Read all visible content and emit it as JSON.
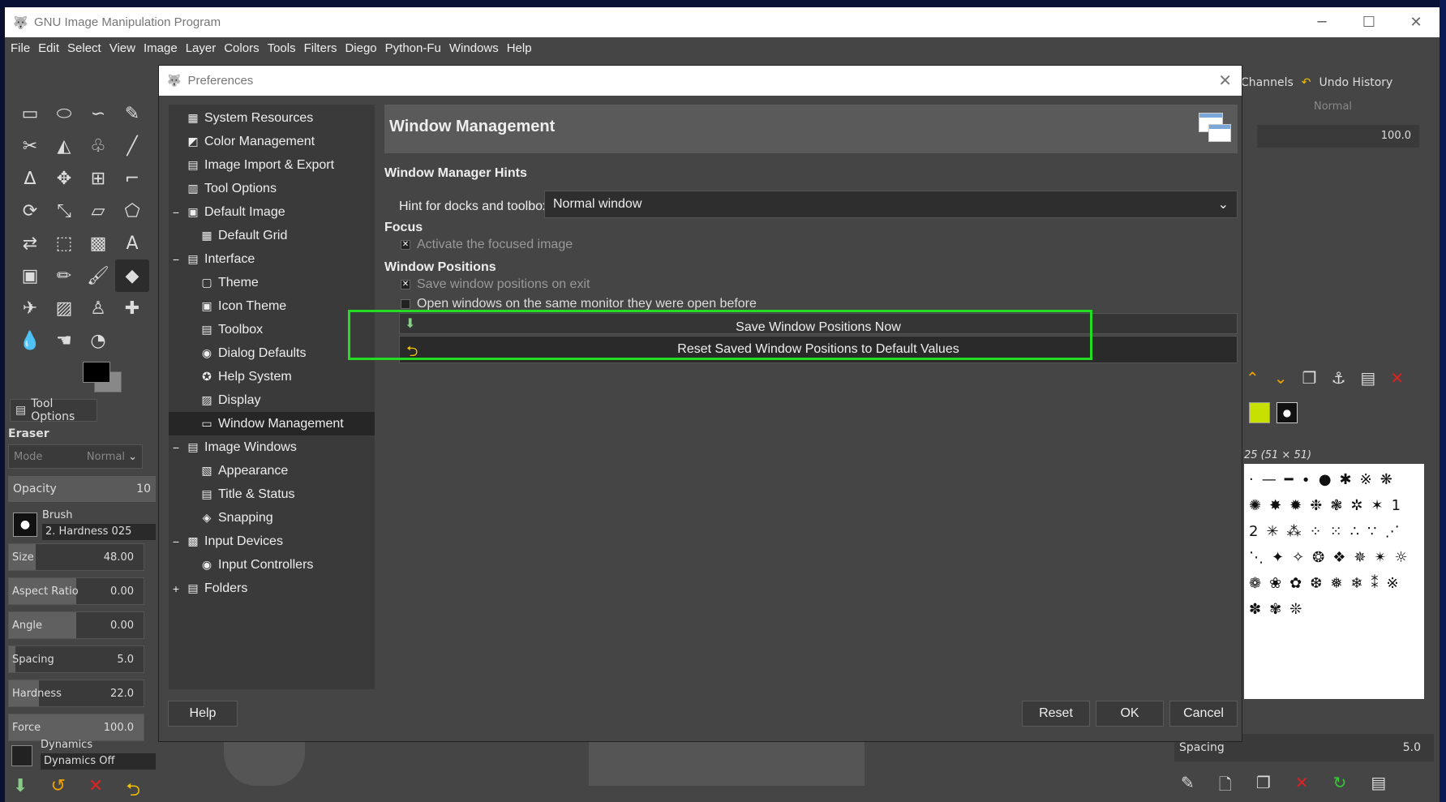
{
  "app": {
    "title": "GNU Image Manipulation Program"
  },
  "menubar": [
    "File",
    "Edit",
    "Select",
    "View",
    "Image",
    "Layer",
    "Colors",
    "Tools",
    "Filters",
    "Diego",
    "Python-Fu",
    "Windows",
    "Help"
  ],
  "toolbox": {
    "tool_options_tab": "Tool Options",
    "tool_name": "Eraser",
    "mode_label": "Mode",
    "mode_value": "Normal",
    "opacity_label": "Opacity",
    "opacity_value": "10",
    "brush_label": "Brush",
    "brush_value": "2. Hardness 025",
    "sliders": [
      {
        "label": "Size",
        "value": "48.00"
      },
      {
        "label": "Aspect Ratio",
        "value": "0.00"
      },
      {
        "label": "Angle",
        "value": "0.00"
      },
      {
        "label": "Spacing",
        "value": "5.0"
      },
      {
        "label": "Hardness",
        "value": "22.0"
      },
      {
        "label": "Force",
        "value": "100.0"
      }
    ],
    "dynamics_label": "Dynamics",
    "dynamics_value": "Dynamics Off"
  },
  "dock": {
    "tab_channels": "Channels",
    "tab_undo_history": "Undo History",
    "mode": "Normal",
    "opacity_value": "100.0",
    "brush_info": "25 (51 × 51)",
    "brush_number": "12",
    "spacing_label": "Spacing",
    "spacing_value": "5.0"
  },
  "dialog": {
    "title": "Preferences",
    "tree": [
      {
        "label": "System Resources",
        "level": 0,
        "icon": "system-resources-icon",
        "glyph": "▦"
      },
      {
        "label": "Color Management",
        "level": 0,
        "icon": "color-management-icon",
        "glyph": "◩"
      },
      {
        "label": "Image Import & Export",
        "level": 0,
        "icon": "image-import-export-icon",
        "glyph": "▤"
      },
      {
        "label": "Tool Options",
        "level": 0,
        "icon": "tool-options-icon",
        "glyph": "▥"
      },
      {
        "label": "Default Image",
        "level": 0,
        "icon": "default-image-icon",
        "glyph": "▣",
        "expander": "−"
      },
      {
        "label": "Default Grid",
        "level": 1,
        "icon": "default-grid-icon",
        "glyph": "▦"
      },
      {
        "label": "Interface",
        "level": 0,
        "icon": "interface-icon",
        "glyph": "▤",
        "expander": "−"
      },
      {
        "label": "Theme",
        "level": 1,
        "icon": "theme-icon",
        "glyph": "▢"
      },
      {
        "label": "Icon Theme",
        "level": 1,
        "icon": "icon-theme-icon",
        "glyph": "▣"
      },
      {
        "label": "Toolbox",
        "level": 1,
        "icon": "toolbox-icon",
        "glyph": "▤"
      },
      {
        "label": "Dialog Defaults",
        "level": 1,
        "icon": "dialog-defaults-icon",
        "glyph": "◉"
      },
      {
        "label": "Help System",
        "level": 1,
        "icon": "help-system-icon",
        "glyph": "✪"
      },
      {
        "label": "Display",
        "level": 1,
        "icon": "display-icon",
        "glyph": "▨"
      },
      {
        "label": "Window Management",
        "level": 1,
        "icon": "window-management-icon",
        "glyph": "▭",
        "selected": true
      },
      {
        "label": "Image Windows",
        "level": 0,
        "icon": "image-windows-icon",
        "glyph": "▤",
        "expander": "−"
      },
      {
        "label": "Appearance",
        "level": 1,
        "icon": "appearance-icon",
        "glyph": "▧"
      },
      {
        "label": "Title & Status",
        "level": 1,
        "icon": "title-status-icon",
        "glyph": "▤"
      },
      {
        "label": "Snapping",
        "level": 1,
        "icon": "snapping-icon",
        "glyph": "◈"
      },
      {
        "label": "Input Devices",
        "level": 0,
        "icon": "input-devices-icon",
        "glyph": "▩",
        "expander": "−"
      },
      {
        "label": "Input Controllers",
        "level": 1,
        "icon": "input-controllers-icon",
        "glyph": "◉"
      },
      {
        "label": "Folders",
        "level": 0,
        "icon": "folders-icon",
        "glyph": "▤",
        "expander": "+"
      }
    ],
    "page_title": "Window Management",
    "wm_hints_title": "Window Manager Hints",
    "hint_label": "Hint for docks and toolbox:",
    "hint_value": "Normal window",
    "focus_title": "Focus",
    "focus_checkbox": "Activate the focused image",
    "positions_title": "Window Positions",
    "save_on_exit_checkbox": "Save window positions on exit",
    "same_monitor_checkbox": "Open windows on the same monitor they were open before",
    "save_now_button": "Save Window Positions Now",
    "reset_button": "Reset Saved Window Positions to Default Values",
    "help_button": "Help",
    "reset_dialog_button": "Reset",
    "ok_button": "OK",
    "cancel_button": "Cancel"
  },
  "colors": {
    "highlight": "#22dd22",
    "background": "#454545"
  }
}
